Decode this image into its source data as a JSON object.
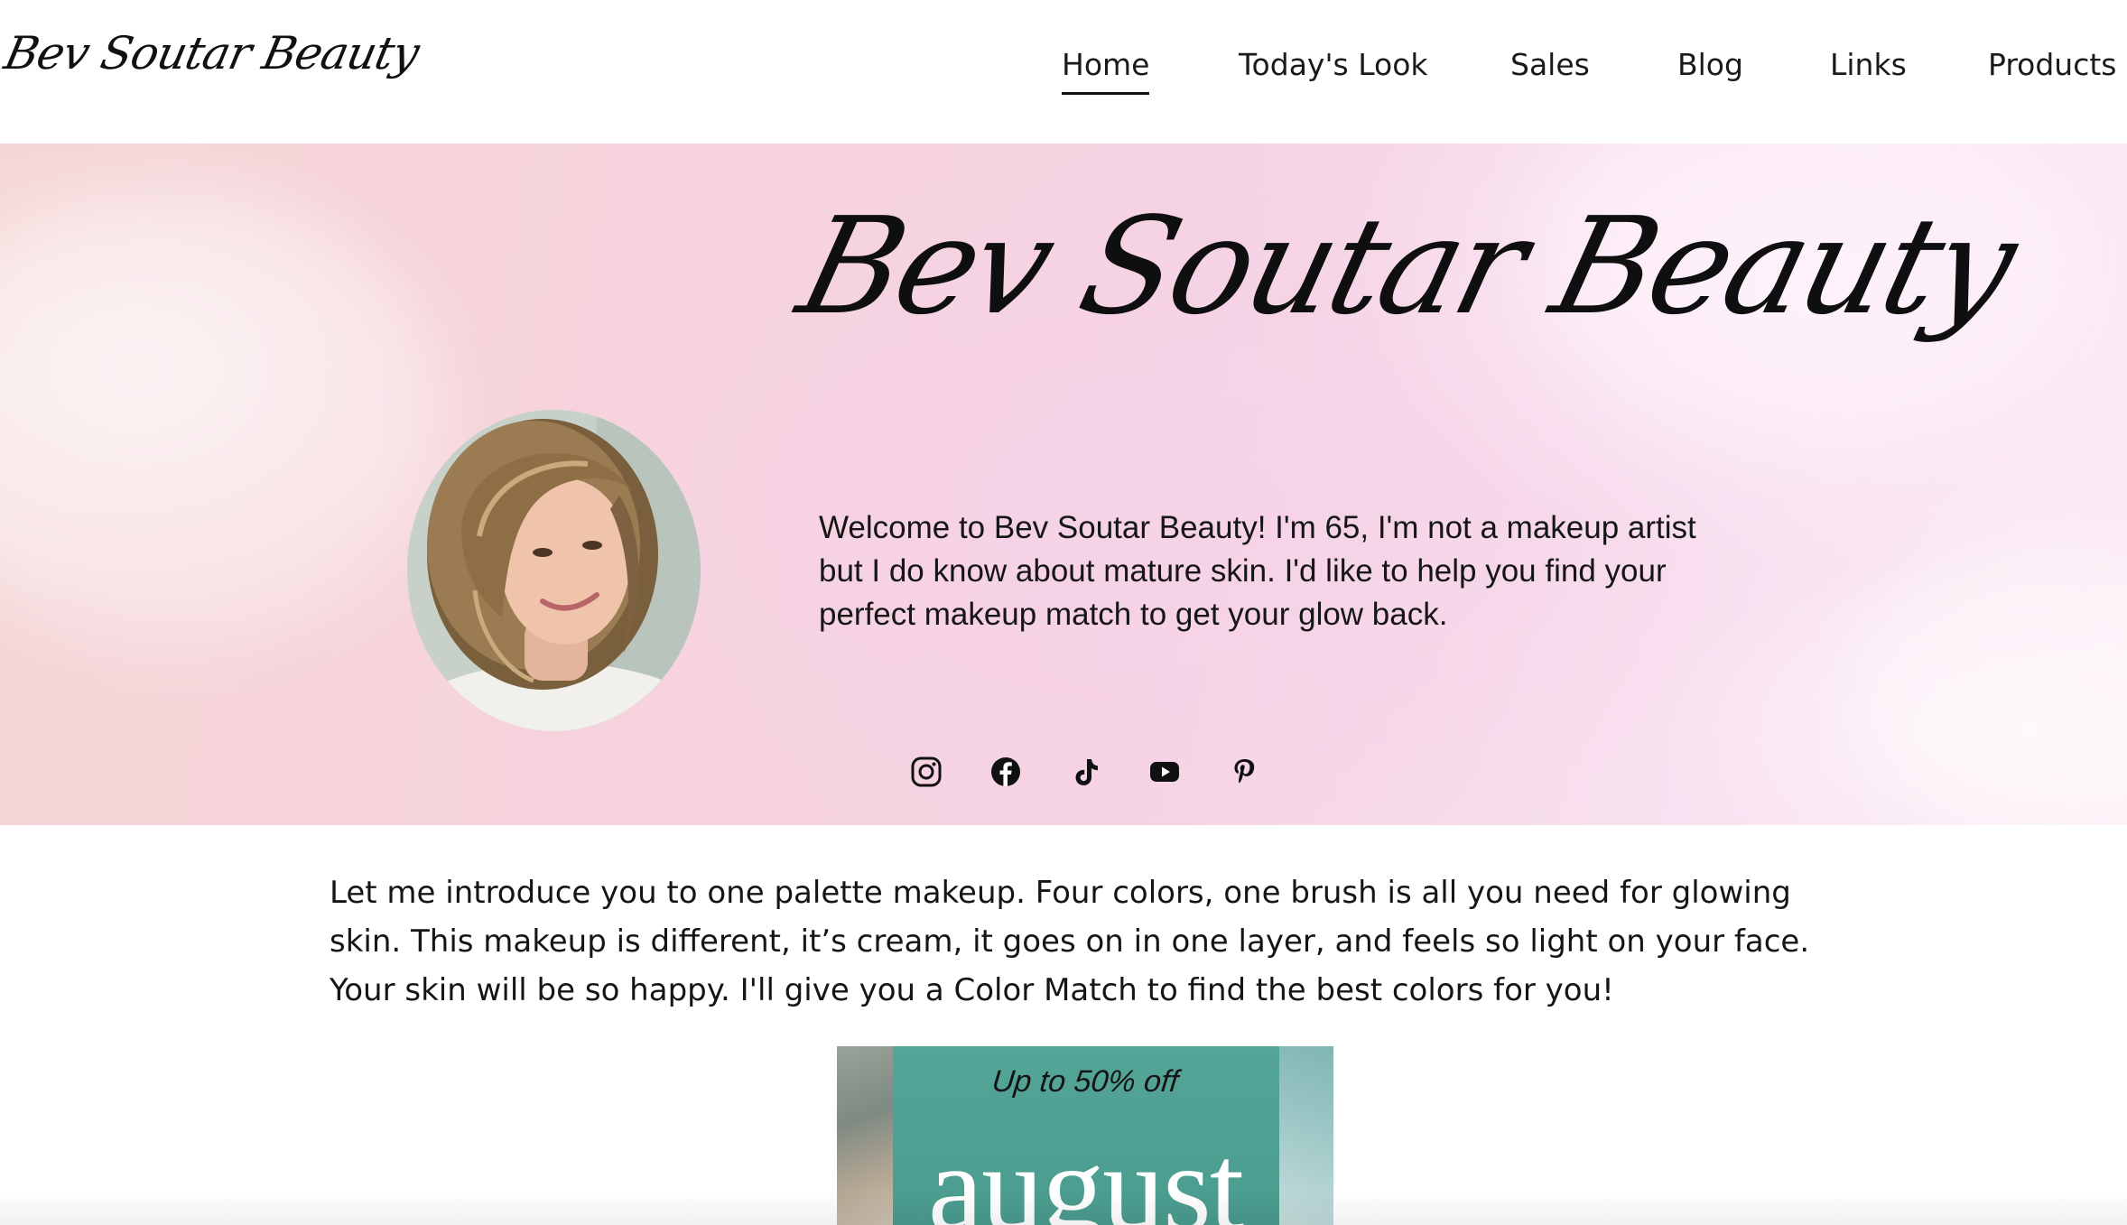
{
  "header": {
    "logo": "Bev Soutar Beauty",
    "nav": [
      {
        "label": "Home",
        "active": true
      },
      {
        "label": "Today's Look",
        "active": false
      },
      {
        "label": "Sales",
        "active": false
      },
      {
        "label": "Blog",
        "active": false
      },
      {
        "label": "Links",
        "active": false
      },
      {
        "label": "Products",
        "active": false
      }
    ]
  },
  "hero": {
    "title": "Bev Soutar Beauty",
    "welcome": "Welcome to Bev Soutar Beauty! I'm 65, I'm not a makeup artist but I do know about mature skin. I'd like to help you find your perfect makeup match to get your glow back.",
    "social": [
      {
        "icon": "instagram-icon"
      },
      {
        "icon": "facebook-icon"
      },
      {
        "icon": "tiktok-icon"
      },
      {
        "icon": "youtube-icon"
      },
      {
        "icon": "pinterest-icon"
      }
    ]
  },
  "intro": {
    "text": "Let me introduce you to one palette makeup. Four colors, one brush is all you need for glowing skin. This makeup is different, it’s cream, it goes on in one layer, and feels so light on your face. Your skin will be so happy. I'll give you a Color Match to find the best colors for you!"
  },
  "promo": {
    "subtitle": "Up to 50% off",
    "headline": "august"
  },
  "colors": {
    "hero_pink": "#f6d3dc",
    "promo_teal": "#4a9e92",
    "text": "#161616"
  }
}
